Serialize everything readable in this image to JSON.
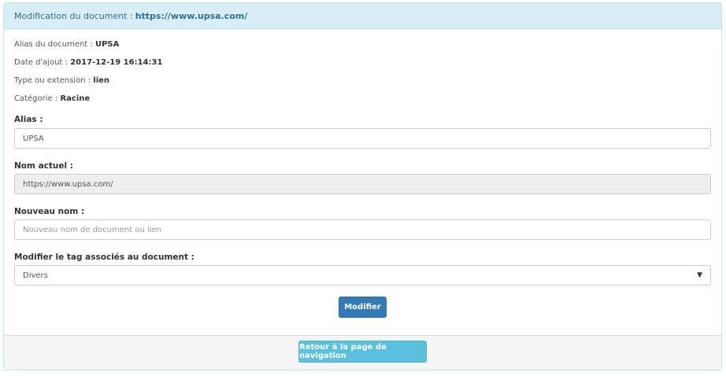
{
  "header": {
    "prefix": "Modification du document :",
    "value": "https://www.upsa.com/"
  },
  "info": [
    {
      "label": "Alias du document :",
      "value": "UPSA"
    },
    {
      "label": "Date d'ajout :",
      "value": "2017-12-19 16:14:31"
    },
    {
      "label": "Type ou extension :",
      "value": "lien"
    },
    {
      "label": "Catégorie :",
      "value": "Racine"
    }
  ],
  "form": {
    "alias_label": "Alias :",
    "alias_value": "UPSA",
    "current_name_label": "Nom actuel :",
    "current_name_value": "https://www.upsa.com/",
    "new_name_label": "Nouveau nom :",
    "new_name_placeholder": "Nouveau nom de document ou lien",
    "tag_label": "Modifier le tag associés au document :",
    "tag_selected": "Divers",
    "submit_label": "Modifier"
  },
  "footer": {
    "back_label": "Retour à la page de navigation"
  }
}
